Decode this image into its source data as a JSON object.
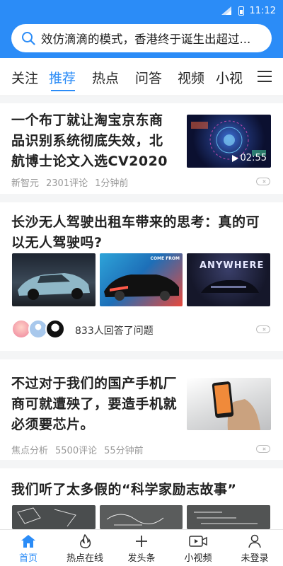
{
  "status": {
    "time": "11:12"
  },
  "search": {
    "query": "效仿滴滴的模式，香港终于诞生出超过..."
  },
  "tabs": [
    "关注",
    "推荐",
    "热点",
    "问答",
    "视频",
    "小视"
  ],
  "feed": {
    "item1": {
      "title": "一个布丁就让淘宝京东商品识别系统彻底失效，北航博士论文入选CV2020",
      "source": "新智元",
      "comments": "2301评论",
      "time": "1分钟前",
      "duration": "02:55"
    },
    "item2": {
      "title": "长沙无人驾驶出租车带来的思考：真的可以无人驾驶吗?",
      "answer_text": "833人回答了问题",
      "thumb2_text": "COME FROM",
      "thumb3_text": "ANYWHERE"
    },
    "item3": {
      "title": "不过对于我们的国产手机厂商可就遭殃了，要造手机就必须要芯片。",
      "source": "焦点分析",
      "comments": "5500评论",
      "time": "55分钟前"
    },
    "item4": {
      "title": "我们听了太多假的“科学家励志故事”"
    }
  },
  "bottom_nav": [
    {
      "label": "首页",
      "icon": "home-icon"
    },
    {
      "label": "热点在线",
      "icon": "flame-icon"
    },
    {
      "label": "发头条",
      "icon": "plus-icon"
    },
    {
      "label": "小视频",
      "icon": "video-icon"
    },
    {
      "label": "未登录",
      "icon": "user-icon"
    }
  ],
  "colors": {
    "accent": "#2b8cf7"
  }
}
